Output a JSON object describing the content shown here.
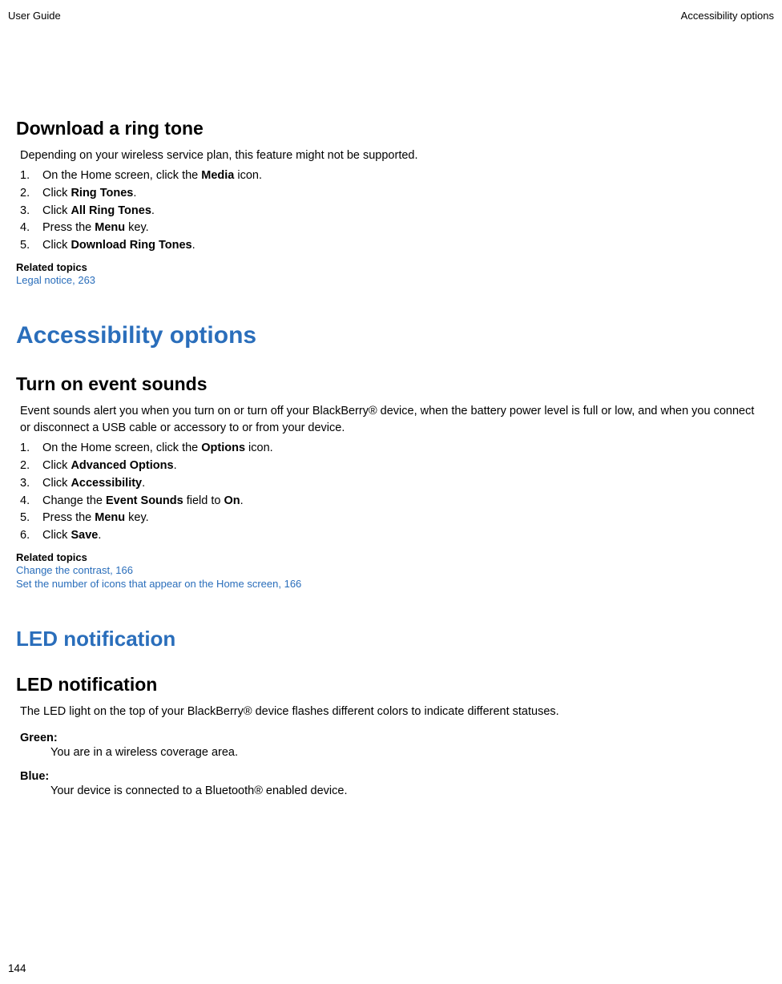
{
  "header": {
    "left": "User Guide",
    "right": "Accessibility options"
  },
  "section1": {
    "title": "Download a ring tone",
    "intro": "Depending on your wireless service plan, this feature might not be supported.",
    "steps": [
      {
        "pre": "On the Home screen, click the ",
        "bold": "Media",
        "post": " icon."
      },
      {
        "pre": "Click ",
        "bold": "Ring Tones",
        "post": "."
      },
      {
        "pre": "Click ",
        "bold": "All Ring Tones",
        "post": "."
      },
      {
        "pre": "Press the ",
        "bold": "Menu",
        "post": " key."
      },
      {
        "pre": "Click ",
        "bold": "Download Ring Tones",
        "post": "."
      }
    ],
    "related": {
      "heading": "Related topics",
      "links": [
        "Legal notice, 263"
      ]
    }
  },
  "section2": {
    "major": "Accessibility options",
    "title": "Turn on event sounds",
    "intro": "Event sounds alert you when you turn on or turn off your BlackBerry® device, when the battery power level is full or low, and when you connect or disconnect a USB cable or accessory to or from your device.",
    "steps": [
      {
        "pre": "On the Home screen, click the ",
        "bold": "Options",
        "post": " icon."
      },
      {
        "pre": "Click ",
        "bold": "Advanced Options",
        "post": "."
      },
      {
        "pre": "Click ",
        "bold": "Accessibility",
        "post": "."
      },
      {
        "pre": "Change the ",
        "bold": "Event Sounds",
        "post": " field to ",
        "bold2": "On",
        "post2": "."
      },
      {
        "pre": "Press the ",
        "bold": "Menu",
        "post": " key."
      },
      {
        "pre": "Click ",
        "bold": "Save",
        "post": "."
      }
    ],
    "related": {
      "heading": "Related topics",
      "links": [
        "Change the contrast, 166",
        "Set the number of icons that appear on the Home screen, 166"
      ]
    }
  },
  "section3": {
    "major": "LED notification",
    "title": "LED notification",
    "intro": "The LED light on the top of your BlackBerry® device flashes different colors to indicate different statuses.",
    "items": [
      {
        "term": "Green",
        "def": "You are in a wireless coverage area."
      },
      {
        "term": "Blue",
        "def": "Your device is connected to a Bluetooth® enabled device."
      }
    ]
  },
  "pageNumber": "144"
}
